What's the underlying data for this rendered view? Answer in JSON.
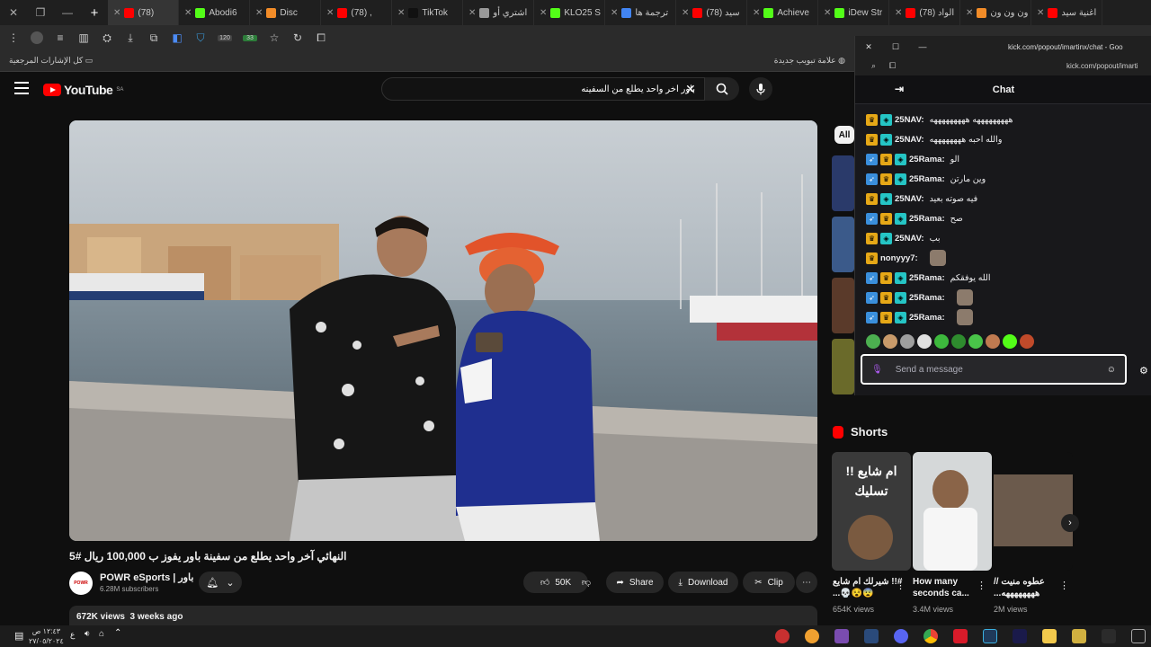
{
  "browser": {
    "tabs": [
      {
        "label": "(78) ",
        "color": "#ff0000"
      },
      {
        "label": "Abodi6",
        "color": "#53fc18"
      },
      {
        "label": "Disc",
        "color": "#f28c28"
      },
      {
        "label": "(78) ,",
        "color": "#ff0000"
      },
      {
        "label": "TikTok",
        "color": "#111111"
      },
      {
        "label": "اشتري أو",
        "color": "#999999"
      },
      {
        "label": "KLO25 S",
        "color": "#53fc18"
      },
      {
        "label": "ترجمة ها",
        "color": "#4285f4"
      },
      {
        "label": "(78) سيد",
        "color": "#ff0000"
      },
      {
        "label": "Achieve",
        "color": "#53fc18"
      },
      {
        "label": "iDew Str",
        "color": "#53fc18"
      },
      {
        "label": "(78) الواد",
        "color": "#ff0000"
      },
      {
        "label": "ون ون ون",
        "color": "#f28c28"
      },
      {
        "label": "اغنية سيد",
        "color": "#ff0000"
      }
    ],
    "toolbar_badges": {
      "left": "120",
      "right": "33"
    },
    "bookmarks_folder": "كل الإشارات المرجعية",
    "new_tab_label": "علامة تبويب جديدة"
  },
  "youtube": {
    "logo_text": "YouTube",
    "region": "SA",
    "search_query": "باور اخر واحد يطلع من السفينه",
    "video": {
      "title": "النهائي آخر واحد يطلع من سفينة باور يفوز ب 100,000 ريال #5",
      "channel": "POWR eSports | باور",
      "subscribers": "6.28M subscribers",
      "likes": "50K",
      "share_label": "Share",
      "download_label": "Download",
      "clip_label": "Clip",
      "views": "672K views",
      "age": "3 weeks ago"
    },
    "filter_all": "All",
    "shorts_heading": "Shorts",
    "shorts": [
      {
        "title": "#!! شيرلك ام شايع 😨😵💀...",
        "views": "654K views",
        "caption": "ام شايع !! تسليك"
      },
      {
        "title": "How many seconds ca...",
        "views": "3.4M views",
        "caption": ""
      },
      {
        "title": "عطوه منيت //ههههههههه...",
        "views": "2M views",
        "caption": ""
      }
    ]
  },
  "chat": {
    "window_url": "kick.com/popout/imartinx/chat - Goo",
    "address": "kick.com/popout/imarti",
    "header": "Chat",
    "messages": [
      {
        "user": "25NAV:",
        "text": "هههههههههه هههههههههه",
        "badges": [
          "crown",
          "sub"
        ]
      },
      {
        "user": "25NAV:",
        "text": "والله احبه ههههههههه",
        "badges": [
          "crown",
          "sub"
        ]
      },
      {
        "user": "25Rama:",
        "text": "الو",
        "badges": [
          "blue",
          "crown",
          "sub"
        ]
      },
      {
        "user": "25Rama:",
        "text": "وين مارتن",
        "badges": [
          "blue",
          "crown",
          "sub"
        ]
      },
      {
        "user": "25NAV:",
        "text": "فيه صوته بعيد",
        "badges": [
          "crown",
          "sub"
        ]
      },
      {
        "user": "25Rama:",
        "text": "صح",
        "badges": [
          "blue",
          "crown",
          "sub"
        ]
      },
      {
        "user": "25NAV:",
        "text": "بب",
        "badges": [
          "crown",
          "sub"
        ]
      },
      {
        "user": "nonyyy7:",
        "text": "",
        "badges": [
          "crown"
        ]
      },
      {
        "user": "25Rama:",
        "text": "الله يوفقكم",
        "badges": [
          "blue",
          "crown",
          "sub"
        ]
      },
      {
        "user": "25Rama:",
        "text": "",
        "badges": [
          "blue",
          "crown",
          "sub"
        ]
      },
      {
        "user": "25Rama:",
        "text": "",
        "badges": [
          "blue",
          "crown",
          "sub"
        ]
      }
    ],
    "input_placeholder": "Send a message"
  },
  "taskbar": {
    "time": "١٢:٤٣ ص",
    "date": "٢٧/٠٥/٢٠٢٤",
    "lang": "ع"
  }
}
